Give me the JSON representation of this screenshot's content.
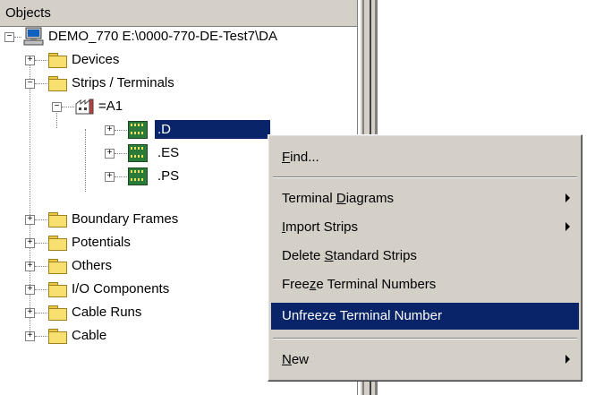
{
  "panel": {
    "header": "Objects"
  },
  "tree": {
    "root": "DEMO_770 E:\\0000-770-DE-Test7\\DA",
    "devices": "Devices",
    "strips_terminals": "Strips / Terminals",
    "a1": "=A1",
    "d": ".D",
    "es": ".ES",
    "ps": ".PS",
    "boundary_frames": "Boundary Frames",
    "potentials": "Potentials",
    "others": "Others",
    "io_components": "I/O Components",
    "cable_runs": "Cable Runs",
    "cable": "Cable"
  },
  "menu": {
    "find": {
      "pre": "",
      "key": "F",
      "post": "ind..."
    },
    "terminal_diagrams": {
      "pre": "Terminal ",
      "key": "D",
      "post": "iagrams"
    },
    "import_strips": {
      "pre": "",
      "key": "I",
      "post": "mport Strips"
    },
    "delete_standard_strips": {
      "pre": "Delete ",
      "key": "S",
      "post": "tandard Strips"
    },
    "freeze_terminal_numbers": {
      "pre": "Free",
      "key": "z",
      "post": "e Terminal Numbers"
    },
    "unfreeze_terminal_number": "Unfreeze Terminal Number",
    "new": {
      "pre": "",
      "key": "N",
      "post": "ew"
    }
  },
  "colors": {
    "selection": "#0a246a",
    "face": "#d4d0c8",
    "folder": "#f8e070",
    "strip": "#2a7a3a"
  }
}
